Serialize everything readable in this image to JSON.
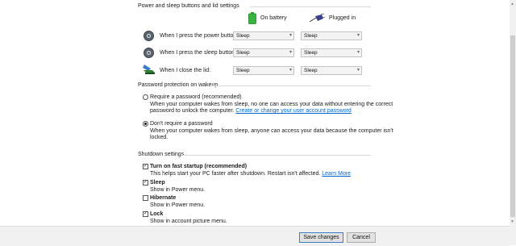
{
  "power_buttons": {
    "section_title": "Power and sleep buttons and lid settings",
    "col_battery": "On battery",
    "col_plugged": "Plugged in",
    "rows": [
      {
        "label": "When I press the power button:",
        "battery": "Sleep",
        "plugged": "Sleep",
        "icon": "power-button-icon"
      },
      {
        "label": "When I press the sleep button:",
        "battery": "Sleep",
        "plugged": "Sleep",
        "icon": "sleep-button-icon"
      },
      {
        "label": "When I close the lid:",
        "battery": "Sleep",
        "plugged": "Sleep",
        "icon": "laptop-lid-icon"
      }
    ]
  },
  "password": {
    "section_title": "Password protection on wakeup",
    "require_label": "Require a password (recommended)",
    "require_desc1": "When your computer wakes from sleep, no one can access your data without entering the correct",
    "require_desc2": "password to unlock the computer.",
    "require_link": "Create or change your user account password",
    "dont_label": "Don't require a password",
    "dont_desc1": "When your computer wakes from sleep, anyone can access your data because the computer isn't",
    "dont_desc2": "locked.",
    "selected": "dont_require"
  },
  "shutdown": {
    "section_title": "Shutdown settings",
    "items": [
      {
        "label": "Turn on fast startup (recommended)",
        "desc": "This helps start your PC faster after shutdown. Restart isn't affected.",
        "link": "Learn More",
        "checked": true
      },
      {
        "label": "Sleep",
        "desc": "Show in Power menu.",
        "checked": true
      },
      {
        "label": "Hibernate",
        "desc": "Show in Power menu.",
        "checked": false
      },
      {
        "label": "Lock",
        "desc": "Show in account picture menu.",
        "checked": true
      }
    ]
  },
  "footer": {
    "save_label": "Save changes",
    "cancel_label": "Cancel"
  },
  "colors": {
    "link": "#0066cc",
    "battery_icon": "#2fa836",
    "plug_icon": "#3a3f8a"
  }
}
